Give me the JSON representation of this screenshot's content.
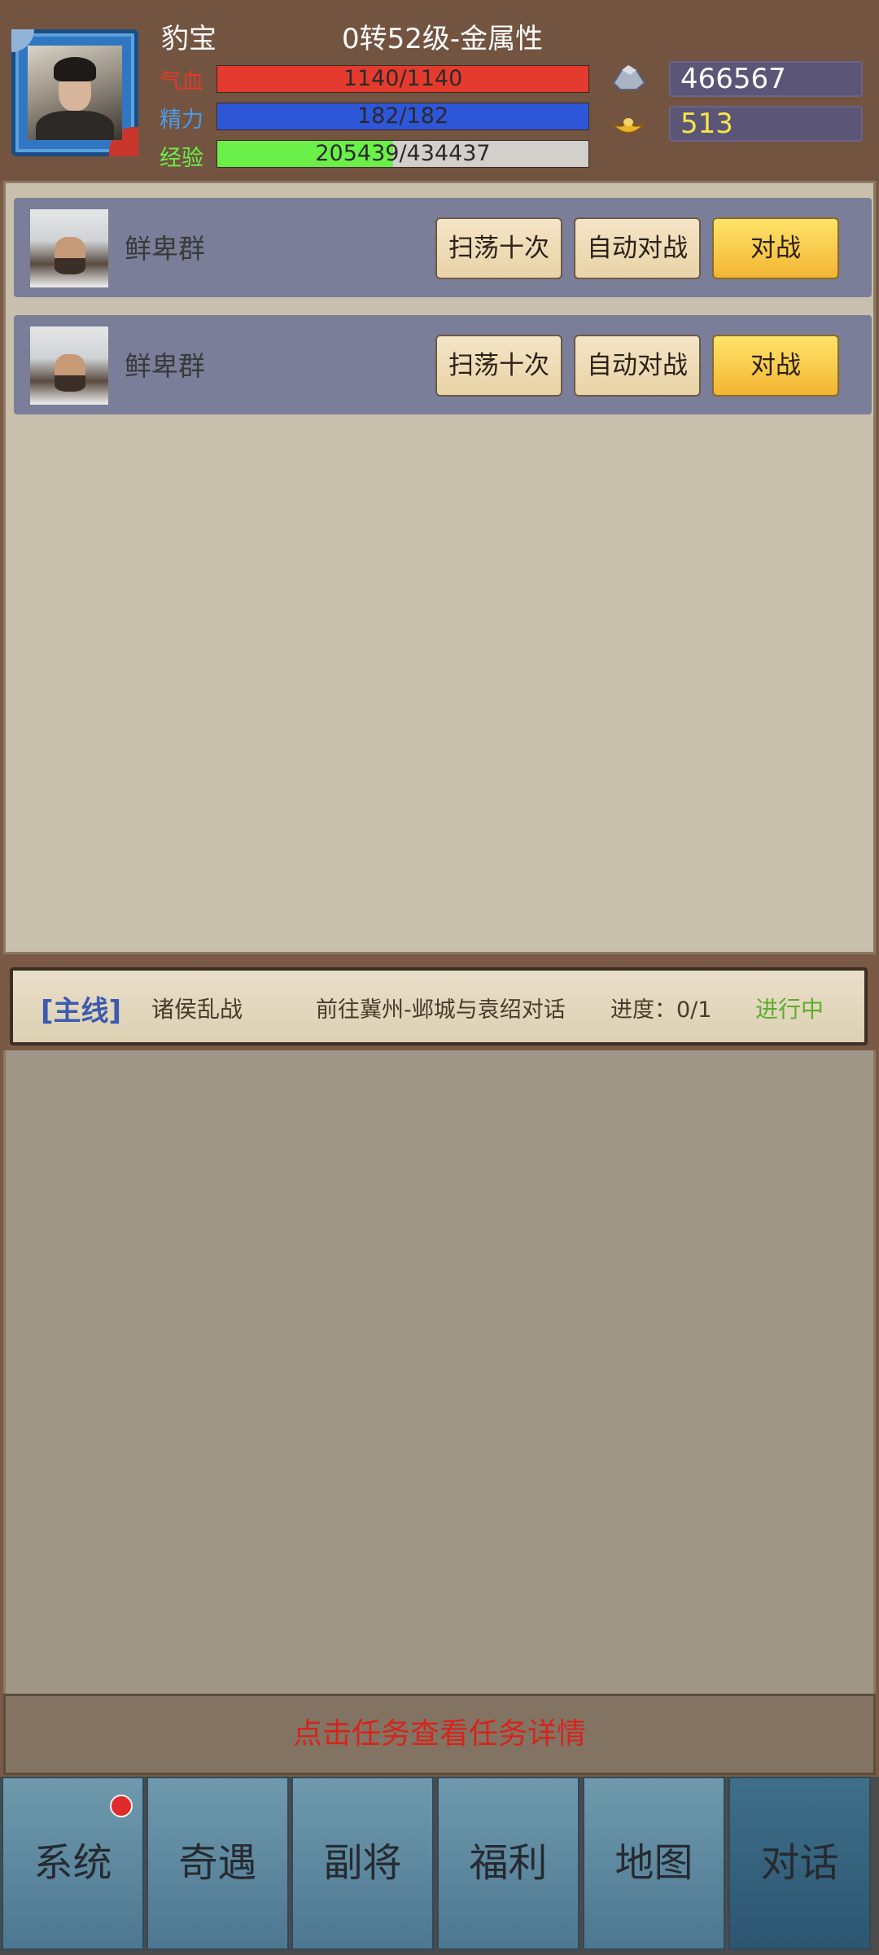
{
  "player": {
    "name": "豹宝",
    "level": "0转52级-金属性",
    "hp_label": "气血",
    "hp_text": "1140/1140",
    "hp_fraction": 1.0,
    "energy_label": "精力",
    "energy_text": "182/182",
    "energy_fraction": 1.0,
    "exp_label": "经验",
    "exp_text": "205439/434437",
    "exp_fraction": 0.473,
    "silver": "466567",
    "gold": "513"
  },
  "enemies": [
    {
      "name": "鲜卑群",
      "sweep": "扫荡十次",
      "auto": "自动对战",
      "fight": "对战"
    },
    {
      "name": "鲜卑群",
      "sweep": "扫荡十次",
      "auto": "自动对战",
      "fight": "对战"
    }
  ],
  "quest": {
    "tag": "[主线]",
    "title": "诸侯乱战",
    "desc": "前往冀州-邺城与袁绍对话",
    "progress": "进度：0/1",
    "status": "进行中"
  },
  "hint": "点击任务查看任务详情",
  "nav": [
    "系统",
    "奇遇",
    "副将",
    "福利",
    "地图",
    "对话"
  ],
  "colors": {
    "hp": "#e43b2e",
    "energy": "#2e57d8",
    "exp": "#6bf04a",
    "silver_text": "#ffffff",
    "gold_text": "#f5e547"
  },
  "icons": {
    "silver": "silver-ingot-icon",
    "gold": "gold-ingot-icon"
  }
}
